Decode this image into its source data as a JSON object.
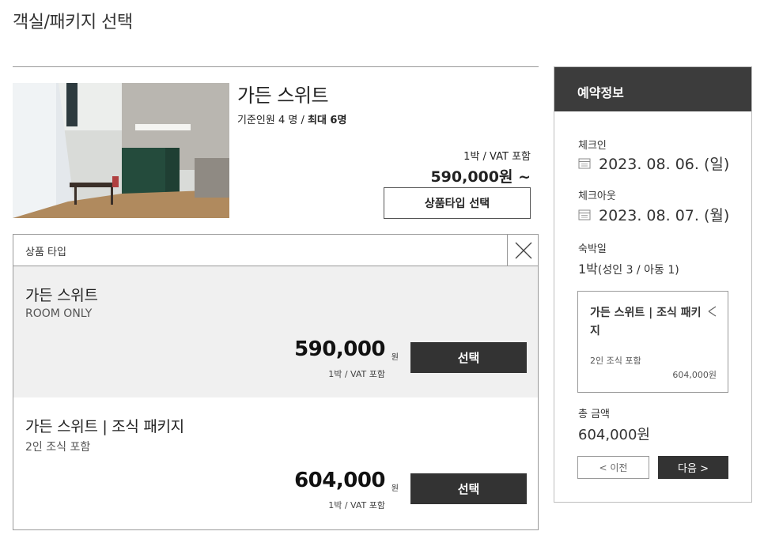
{
  "page": {
    "title": "객실/패키지 선택"
  },
  "room": {
    "name": "가든 스위트",
    "occupancy_base": "기준인원 4 명 / ",
    "occupancy_max": "최대 6명",
    "price_note": "1박 / VAT 포함",
    "price": "590,000원 ~",
    "select_type_label": "상품타입 선택"
  },
  "type_panel": {
    "header": "상품 타입",
    "options": [
      {
        "name": "가든 스위트",
        "sub": "ROOM ONLY",
        "price": "590,000",
        "currency": "원",
        "note": "1박 / VAT 포함",
        "button": "선택",
        "selected": true
      },
      {
        "name": "가든 스위트 | 조식 패키지",
        "sub": "2인 조식 포함",
        "price": "604,000",
        "currency": "원",
        "note": "1박 / VAT 포함",
        "button": "선택",
        "selected": false
      }
    ]
  },
  "booking": {
    "header": "예약정보",
    "checkin_label": "체크인",
    "checkin_date": "2023. 08. 06. (일)",
    "checkout_label": "체크아웃",
    "checkout_date": "2023. 08. 07. (월)",
    "nights_label": "숙박일",
    "nights_value": "1박",
    "nights_detail": "(성인 3 / 아동 1)",
    "cart": {
      "name": "가든 스위트 | 조식 패키지",
      "sub": "2인 조식 포함",
      "price": "604,000원"
    },
    "total_label": "총 금액",
    "total_value": "604,000원",
    "prev_label": "< 이전",
    "next_label": "다음 >"
  },
  "colors": {
    "dark_button": "#333333",
    "header_bg": "#3c3c3c",
    "selected_row": "#f0f0f0",
    "border": "#9a9a9a"
  },
  "icons": [
    "close-icon",
    "calendar-icon",
    "remove-icon"
  ]
}
